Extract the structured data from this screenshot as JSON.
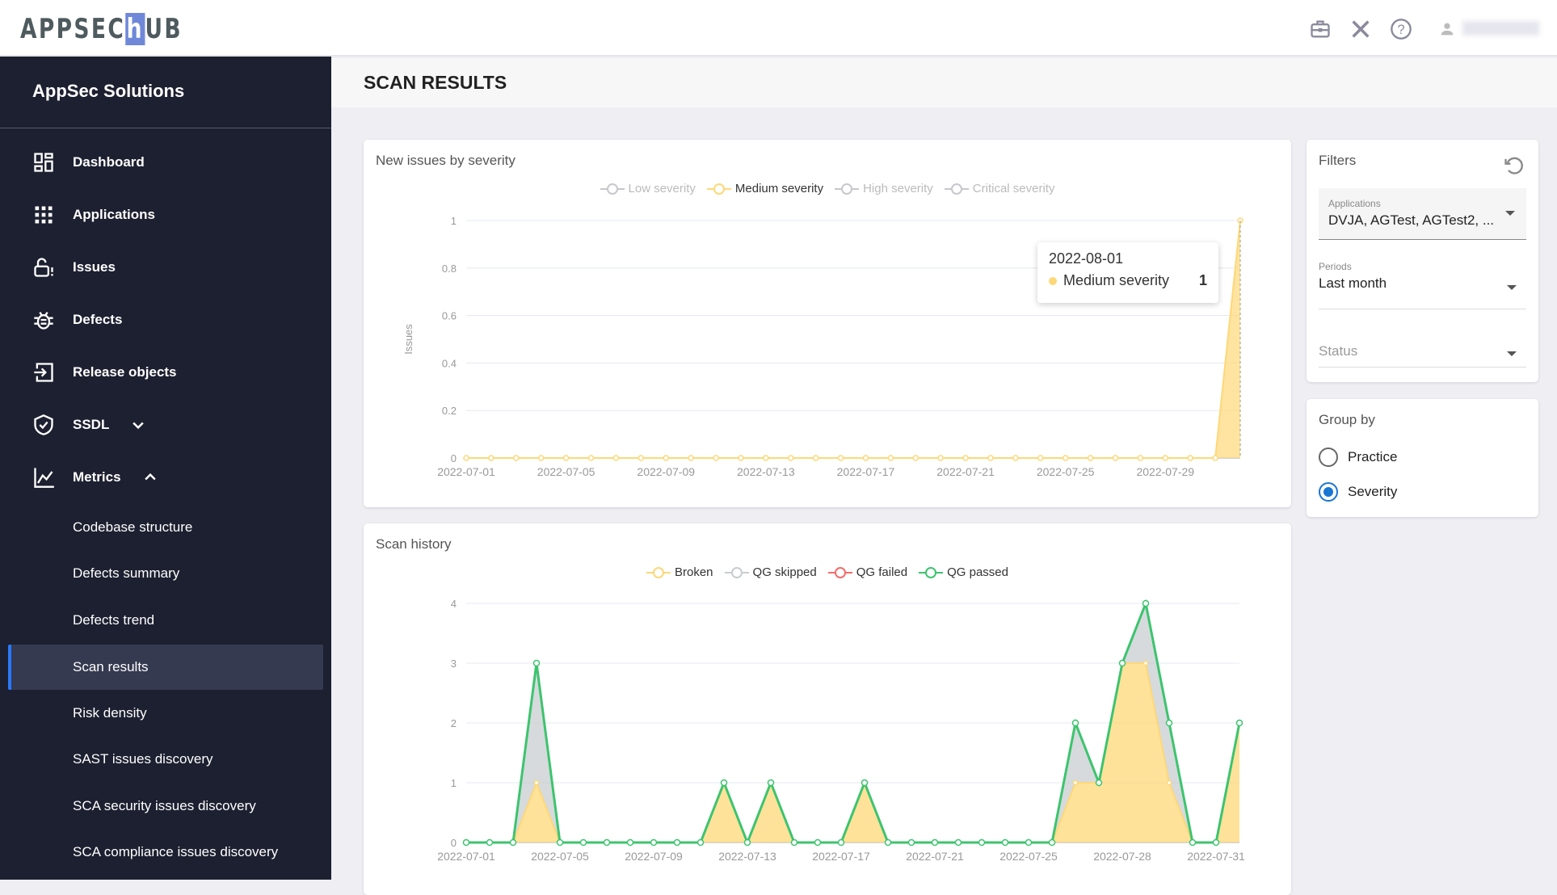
{
  "header": {
    "logo": "APPSECHUB",
    "logo_parts": [
      "APPSEC",
      "h",
      "UB"
    ],
    "icons": [
      "briefcase-icon",
      "tools-icon",
      "help-icon",
      "user-icon"
    ]
  },
  "sidebar": {
    "org": "AppSec Solutions",
    "items": [
      {
        "label": "Dashboard",
        "icon": "dashboard-icon"
      },
      {
        "label": "Applications",
        "icon": "apps-grid-icon"
      },
      {
        "label": "Issues",
        "icon": "unlock-alert-icon"
      },
      {
        "label": "Defects",
        "icon": "bug-icon"
      },
      {
        "label": "Release objects",
        "icon": "login-box-icon"
      },
      {
        "label": "SSDL",
        "icon": "shield-check-icon"
      },
      {
        "label": "Metrics",
        "icon": "chart-line-icon"
      }
    ],
    "subitems": [
      "Codebase structure",
      "Defects summary",
      "Defects trend",
      "Scan results",
      "Risk density",
      "SAST issues discovery",
      "SCA security issues discovery",
      "SCA compliance issues discovery"
    ],
    "active": "Scan results"
  },
  "page": {
    "title": "SCAN RESULTS"
  },
  "filters": {
    "title": "Filters",
    "applications_label": "Applications",
    "applications_value": "DVJA, AGTest, AGTest2, ...",
    "periods_label": "Periods",
    "periods_value": "Last month",
    "status_placeholder": "Status"
  },
  "groupby": {
    "title": "Group by",
    "options": [
      "Practice",
      "Severity"
    ],
    "selected": "Severity"
  },
  "tooltip": {
    "date": "2022-08-01",
    "series": "Medium severity",
    "value": "1"
  },
  "chart_data": [
    {
      "type": "line",
      "title": "New issues by severity",
      "ylabel": "Issues",
      "ylim": [
        0,
        1
      ],
      "yticks": [
        "0",
        "0.2",
        "0.4",
        "0.6",
        "0.8",
        "1"
      ],
      "x": [
        "2022-07-01",
        "2022-07-02",
        "2022-07-03",
        "2022-07-04",
        "2022-07-05",
        "2022-07-06",
        "2022-07-07",
        "2022-07-08",
        "2022-07-09",
        "2022-07-10",
        "2022-07-11",
        "2022-07-12",
        "2022-07-13",
        "2022-07-14",
        "2022-07-15",
        "2022-07-16",
        "2022-07-17",
        "2022-07-18",
        "2022-07-19",
        "2022-07-20",
        "2022-07-21",
        "2022-07-22",
        "2022-07-23",
        "2022-07-24",
        "2022-07-25",
        "2022-07-26",
        "2022-07-27",
        "2022-07-28",
        "2022-07-29",
        "2022-07-30",
        "2022-07-31",
        "2022-08-01"
      ],
      "xticks": [
        "2022-07-01",
        "2022-07-05",
        "2022-07-09",
        "2022-07-13",
        "2022-07-17",
        "2022-07-21",
        "2022-07-25",
        "2022-07-29"
      ],
      "legend": [
        {
          "name": "Low severity",
          "color": "#c8c8cc",
          "enabled": false
        },
        {
          "name": "Medium severity",
          "color": "#fdd878",
          "enabled": true
        },
        {
          "name": "High severity",
          "color": "#c8c8cc",
          "enabled": false
        },
        {
          "name": "Critical severity",
          "color": "#c8c8cc",
          "enabled": false
        }
      ],
      "series": [
        {
          "name": "Medium severity",
          "color": "#fdd878",
          "values": [
            0,
            0,
            0,
            0,
            0,
            0,
            0,
            0,
            0,
            0,
            0,
            0,
            0,
            0,
            0,
            0,
            0,
            0,
            0,
            0,
            0,
            0,
            0,
            0,
            0,
            0,
            0,
            0,
            0,
            0,
            0,
            1
          ]
        }
      ]
    },
    {
      "type": "area",
      "stacked": true,
      "title": "Scan history",
      "ylim": [
        0,
        4
      ],
      "yticks": [
        "0",
        "1",
        "2",
        "3",
        "4"
      ],
      "xticks": [
        {
          "i": 0,
          "label": "2022-07-01"
        },
        {
          "i": 4,
          "label": "2022-07-05"
        },
        {
          "i": 8,
          "label": "2022-07-09"
        },
        {
          "i": 12,
          "label": "2022-07-13"
        },
        {
          "i": 16,
          "label": "2022-07-17"
        },
        {
          "i": 20,
          "label": "2022-07-21"
        },
        {
          "i": 24,
          "label": "2022-07-25"
        },
        {
          "i": 28,
          "label": "2022-07-28"
        },
        {
          "i": 32,
          "label": "2022-07-31"
        }
      ],
      "series": [
        {
          "name": "Broken",
          "color": "#fdd878",
          "values": [
            0,
            0,
            0,
            1,
            0,
            0,
            0,
            0,
            0,
            0,
            0,
            1,
            0,
            1,
            0,
            0,
            0,
            1,
            0,
            0,
            0,
            0,
            0,
            0,
            0,
            0,
            1,
            1,
            3,
            3,
            1,
            0,
            0,
            2
          ]
        },
        {
          "name": "QG skipped",
          "color": "#c8cdd0",
          "values": [
            0,
            0,
            0,
            2,
            0,
            0,
            0,
            0,
            0,
            0,
            0,
            0,
            0,
            0,
            0,
            0,
            0,
            0,
            0,
            0,
            0,
            0,
            0,
            0,
            0,
            0,
            1,
            0,
            0,
            1,
            1,
            0,
            0,
            0
          ]
        },
        {
          "name": "QG failed",
          "color": "#f56c6c",
          "values": [
            0,
            0,
            0,
            0,
            0,
            0,
            0,
            0,
            0,
            0,
            0,
            0,
            0,
            0,
            0,
            0,
            0,
            0,
            0,
            0,
            0,
            0,
            0,
            0,
            0,
            0,
            0,
            0,
            0,
            0,
            0,
            0,
            0,
            0
          ]
        },
        {
          "name": "QG passed",
          "color": "#3cc46e",
          "values": [
            0,
            0,
            0,
            0,
            0,
            0,
            0,
            0,
            0,
            0,
            0,
            0,
            0,
            0,
            0,
            0,
            0,
            0,
            0,
            0,
            0,
            0,
            0,
            0,
            0,
            0,
            0,
            0,
            0,
            0,
            0,
            0,
            0,
            0
          ]
        }
      ]
    }
  ]
}
